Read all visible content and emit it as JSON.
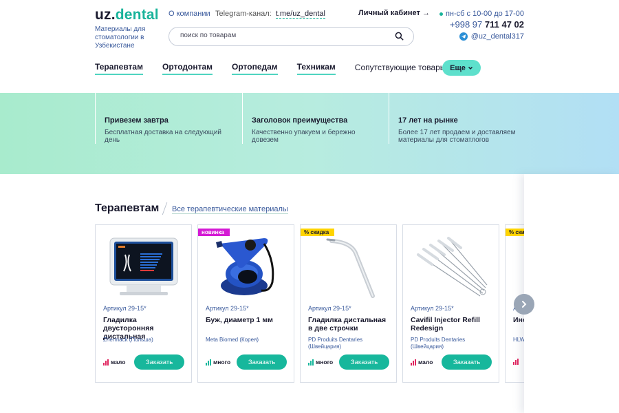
{
  "header": {
    "logo_part1": "uz.",
    "logo_part2": "dental",
    "tagline": "Материалы для стоматологии в Узбекистане",
    "company_link": "О компании",
    "telegram_channel_label": "Telegram-канал:",
    "telegram_channel_link": "t.me/uz_dental",
    "cabinet_label": "Личный кабинет →",
    "hours": "пн-сб с 10-00 до 17-00",
    "phone_code": "+998 97",
    "phone_number": "711 47 02",
    "telegram_handle": "@uz_dental317",
    "search_placeholder": "поиск по товарам"
  },
  "nav": {
    "items": [
      "Терапевтам",
      "Ортодонтам",
      "Ортопедам",
      "Техникам",
      "Сопутствующие товары"
    ],
    "more_label": "Еще"
  },
  "features": [
    {
      "title": "Привезем завтра",
      "desc": "Бесплатная доставка на следующий день"
    },
    {
      "title": "Заголовок преимущества",
      "desc": "Качественно упакуем и бережно довезем"
    },
    {
      "title": "17 лет на рынке",
      "desc": "Более 17 лет продаем  и доставляем материалы для стоматлогов"
    }
  ],
  "section": {
    "title": "Терапевтам",
    "all_link": "Все терапевтические материалы"
  },
  "products": [
    {
      "badge": "",
      "article": "Артикул 29-15*",
      "name": "Гладилка двусторонняя дистальная",
      "maker": "Zhermack (Польша)",
      "stock": "мало",
      "stock_level": 1,
      "order_label": "Заказать"
    },
    {
      "badge": "новинка",
      "article": "Артикул 29-15*",
      "name": "Буж, диаметр 1 мм",
      "maker": "Meta Biomed (Корея)",
      "stock": "много",
      "stock_level": 3,
      "order_label": "Заказать"
    },
    {
      "badge": "% скидка",
      "article": "Артикул 29-15*",
      "name": "Гладилка дистальная в две строчки",
      "maker": "PD Produits Dentaries (Швейцария)",
      "stock": "много",
      "stock_level": 3,
      "order_label": "Заказать"
    },
    {
      "badge": "",
      "article": "Артикул 29-15*",
      "name": "Cavifil Injector Refill Redesign",
      "maker": "PD Produits Dentaries (Швейцария)",
      "stock": "мало",
      "stock_level": 1,
      "order_label": "Заказать"
    },
    {
      "badge": "% ски",
      "article": "Арти",
      "name": "Инс ама",
      "maker": "HLW (Гер",
      "stock": "",
      "stock_level": 1,
      "order_label": ""
    }
  ],
  "colors": {
    "accent": "#17b79c",
    "link": "#3a5a9c",
    "badge_new": "#d41ad4",
    "badge_sale": "#ffd400",
    "stock_low": "#e0245e",
    "stock_high": "#17b79c"
  },
  "icons": {
    "search": "search-icon",
    "telegram": "telegram-icon",
    "chevron": "chevron-down-icon",
    "next": "chevron-right-icon"
  }
}
